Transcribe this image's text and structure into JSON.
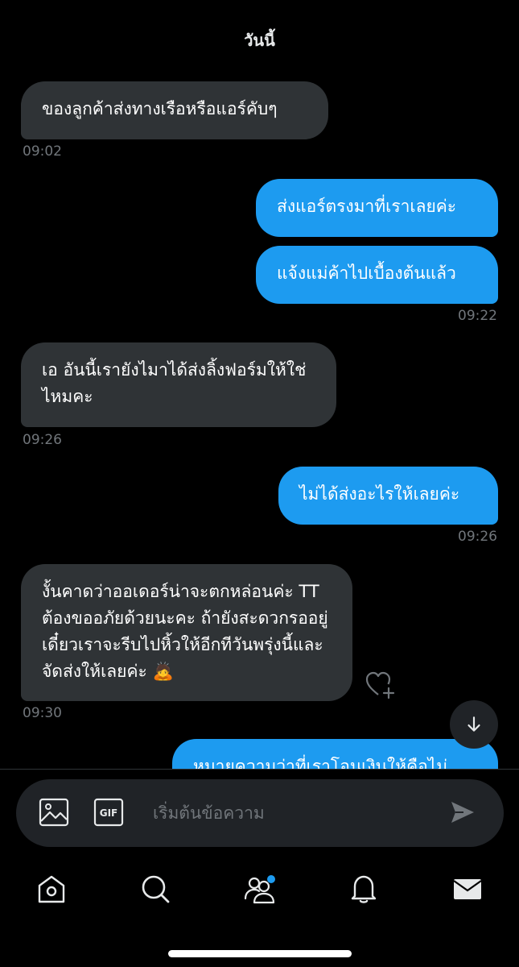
{
  "header": {
    "day_label": "วันนี้"
  },
  "messages": [
    {
      "direction": "in",
      "text": "ของลูกค้าส่งทางเรือหรือแอร์คับๆ",
      "time": "09:02"
    },
    {
      "direction": "out",
      "text": "ส่งแอร์ตรงมาที่เราเลยค่ะ",
      "time": ""
    },
    {
      "direction": "out",
      "text": "แจ้งแม่ค้าไปเบื้องต้นแล้ว",
      "time": "09:22"
    },
    {
      "direction": "in",
      "text": "เอ อันนี้เรายังไมาได้ส่งลิ้งฟอร์มให้ใช่ไหมคะ",
      "time": "09:26"
    },
    {
      "direction": "out",
      "text": "ไม่ได้ส่งอะไรให้เลยค่ะ",
      "time": "09:26"
    },
    {
      "direction": "in",
      "text": "งั้นคาดว่าออเดอร์น่าจะตกหล่อนค่ะ TT ต้องขออภัยด้วยนะคะ ถ้ายังสะดวกรออยู่เดี๋ยวเราจะรีบไปหิ้วให้อีกทีวันพรุ่งนี้และจัดส่งให้เลยค่ะ 🙇",
      "time": "09:30"
    },
    {
      "direction": "out",
      "text": "หมายความว่าที่เราโอนเงินให้คือไม่",
      "time": ""
    }
  ],
  "composer": {
    "placeholder": "เริ่มต้นข้อความ",
    "gif_label": "GIF"
  },
  "tabbar": {
    "items": [
      "home",
      "search",
      "communities",
      "notifications",
      "messages"
    ],
    "communities_has_badge": true
  },
  "colors": {
    "incoming_bubble": "#2f3336",
    "outgoing_bubble": "#1d9bf0",
    "timestamp": "#71767b"
  }
}
